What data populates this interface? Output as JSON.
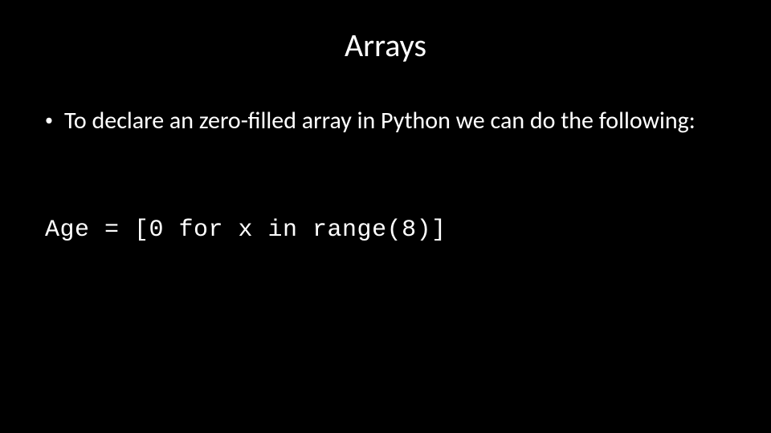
{
  "slide": {
    "title": "Arrays",
    "bullet_text": "To declare an zero-filled array in Python we can do the following:",
    "code": "Age = [0 for x in range(8)]"
  }
}
